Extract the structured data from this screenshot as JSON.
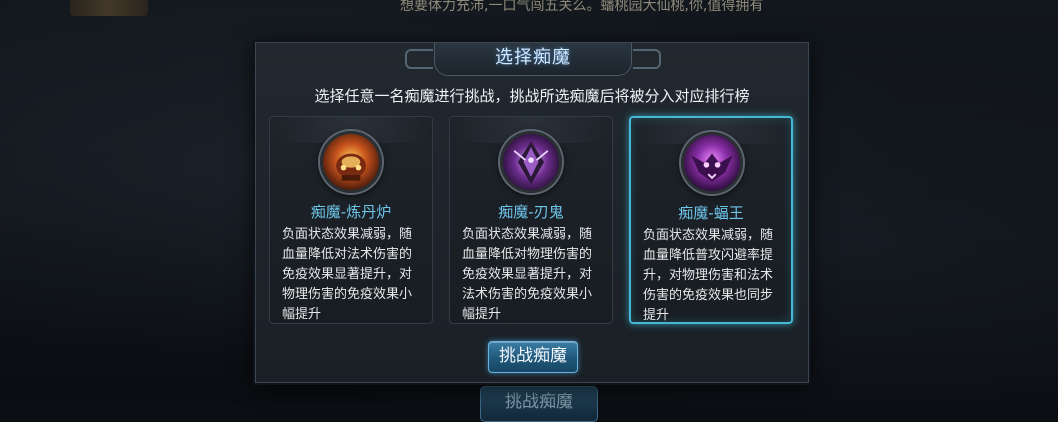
{
  "background": {
    "ticker_text": "想要体力充沛,一口气闯五关么。蟠桃园大仙桃,你,值得拥有",
    "ghost_button_label": "挑战痴魔"
  },
  "dialog": {
    "title": "选择痴魔",
    "instruction": "选择任意一名痴魔进行挑战，挑战所选痴魔后将被分入对应排行榜",
    "challenge_button": "挑战痴魔",
    "cards": [
      {
        "name": "痴魔-炼丹炉",
        "description": "负面状态效果减弱，随血量降低对法术伤害的免疫效果显著提升，对物理伤害的免疫效果小幅提升",
        "portrait_icon": "furnace-demon-icon",
        "selected": false
      },
      {
        "name": "痴魔-刃鬼",
        "description": "负面状态效果减弱，随血量降低对物理伤害的免疫效果显著提升，对法术伤害的免疫效果小幅提升",
        "portrait_icon": "blade-ghost-icon",
        "selected": false
      },
      {
        "name": "痴魔-蝠王",
        "description": "负面状态效果减弱，随血量降低普攻闪避率提升，对物理伤害和法术伤害的免疫效果也同步提升",
        "portrait_icon": "bat-king-icon",
        "selected": true
      }
    ]
  },
  "colors": {
    "selected_border": "#45b7d7",
    "name_text": "#6ec5ea",
    "button": "#1f5779"
  }
}
